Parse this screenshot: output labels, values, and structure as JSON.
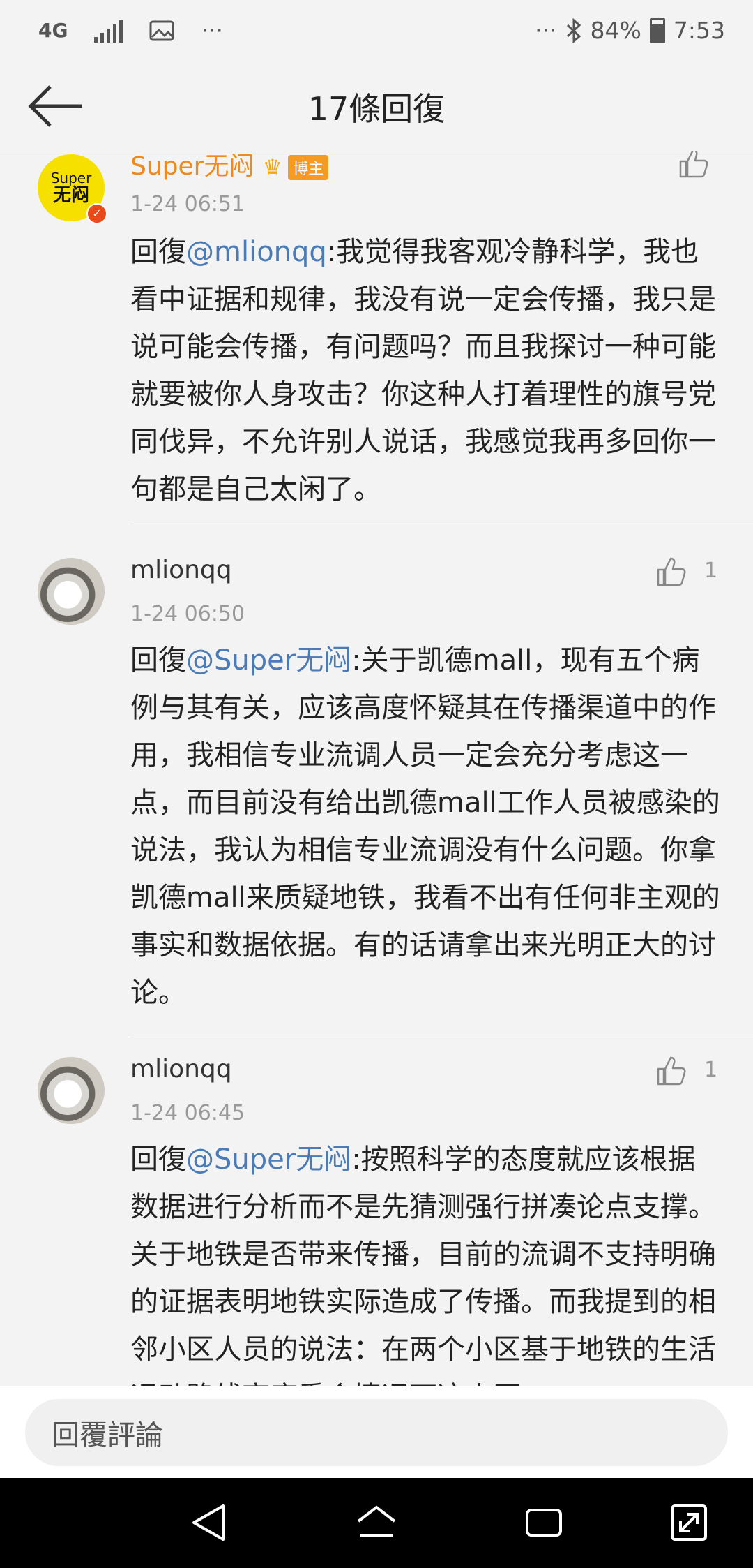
{
  "status": {
    "network": "4G",
    "more": "···",
    "more_right": "···",
    "battery_text": "84%",
    "time": "7:53"
  },
  "header": {
    "title": "17條回復"
  },
  "comments": [
    {
      "user": "Super无闷",
      "avatar_text_top": "Super",
      "avatar_text_bottom": "无闷",
      "crown": "♛",
      "badge": "博主",
      "time": "1-24 06:51",
      "prefix": "回復",
      "mention": "@mlionqq",
      "text": ":我觉得我客观冷静科学，我也看中证据和规律，我没有说一定会传播，我只是说可能会传播，有问题吗？而且我探讨一种可能就要被你人身攻击？你这种人打着理性的旗号党同伐异，不允许别人说话，我感觉我再多回你一句都是自己太闲了。",
      "likes": ""
    },
    {
      "user": "mlionqq",
      "time": "1-24 06:50",
      "prefix": "回復",
      "mention": "@Super无闷",
      "text": ":关于凯德mall，现有五个病例与其有关，应该高度怀疑其在传播渠道中的作用，我相信专业流调人员一定会充分考虑这一点，而目前没有给出凯德mall工作人员被感染的说法，我认为相信专业流调没有什么问题。你拿凯德mall来质疑地铁，我看不出有任何非主观的事实和数据依据。有的话请拿出来光明正大的讨论。",
      "likes": "1"
    },
    {
      "user": "mlionqq",
      "time": "1-24 06:45",
      "prefix": "回復",
      "mention": "@Super无闷",
      "text": ":按照科学的态度就应该根据数据进行分析而不是先猜测强行拼凑论点支撑。 关于地铁是否带来传播，目前的流调不支持明确的证据表明地铁实际造成了传播。而我提到的相邻小区人员的说法：在两个小区基于地铁的生活运动路线高度重合情况下这小区",
      "likes": "1"
    }
  ],
  "input": {
    "placeholder": "回覆評論"
  }
}
